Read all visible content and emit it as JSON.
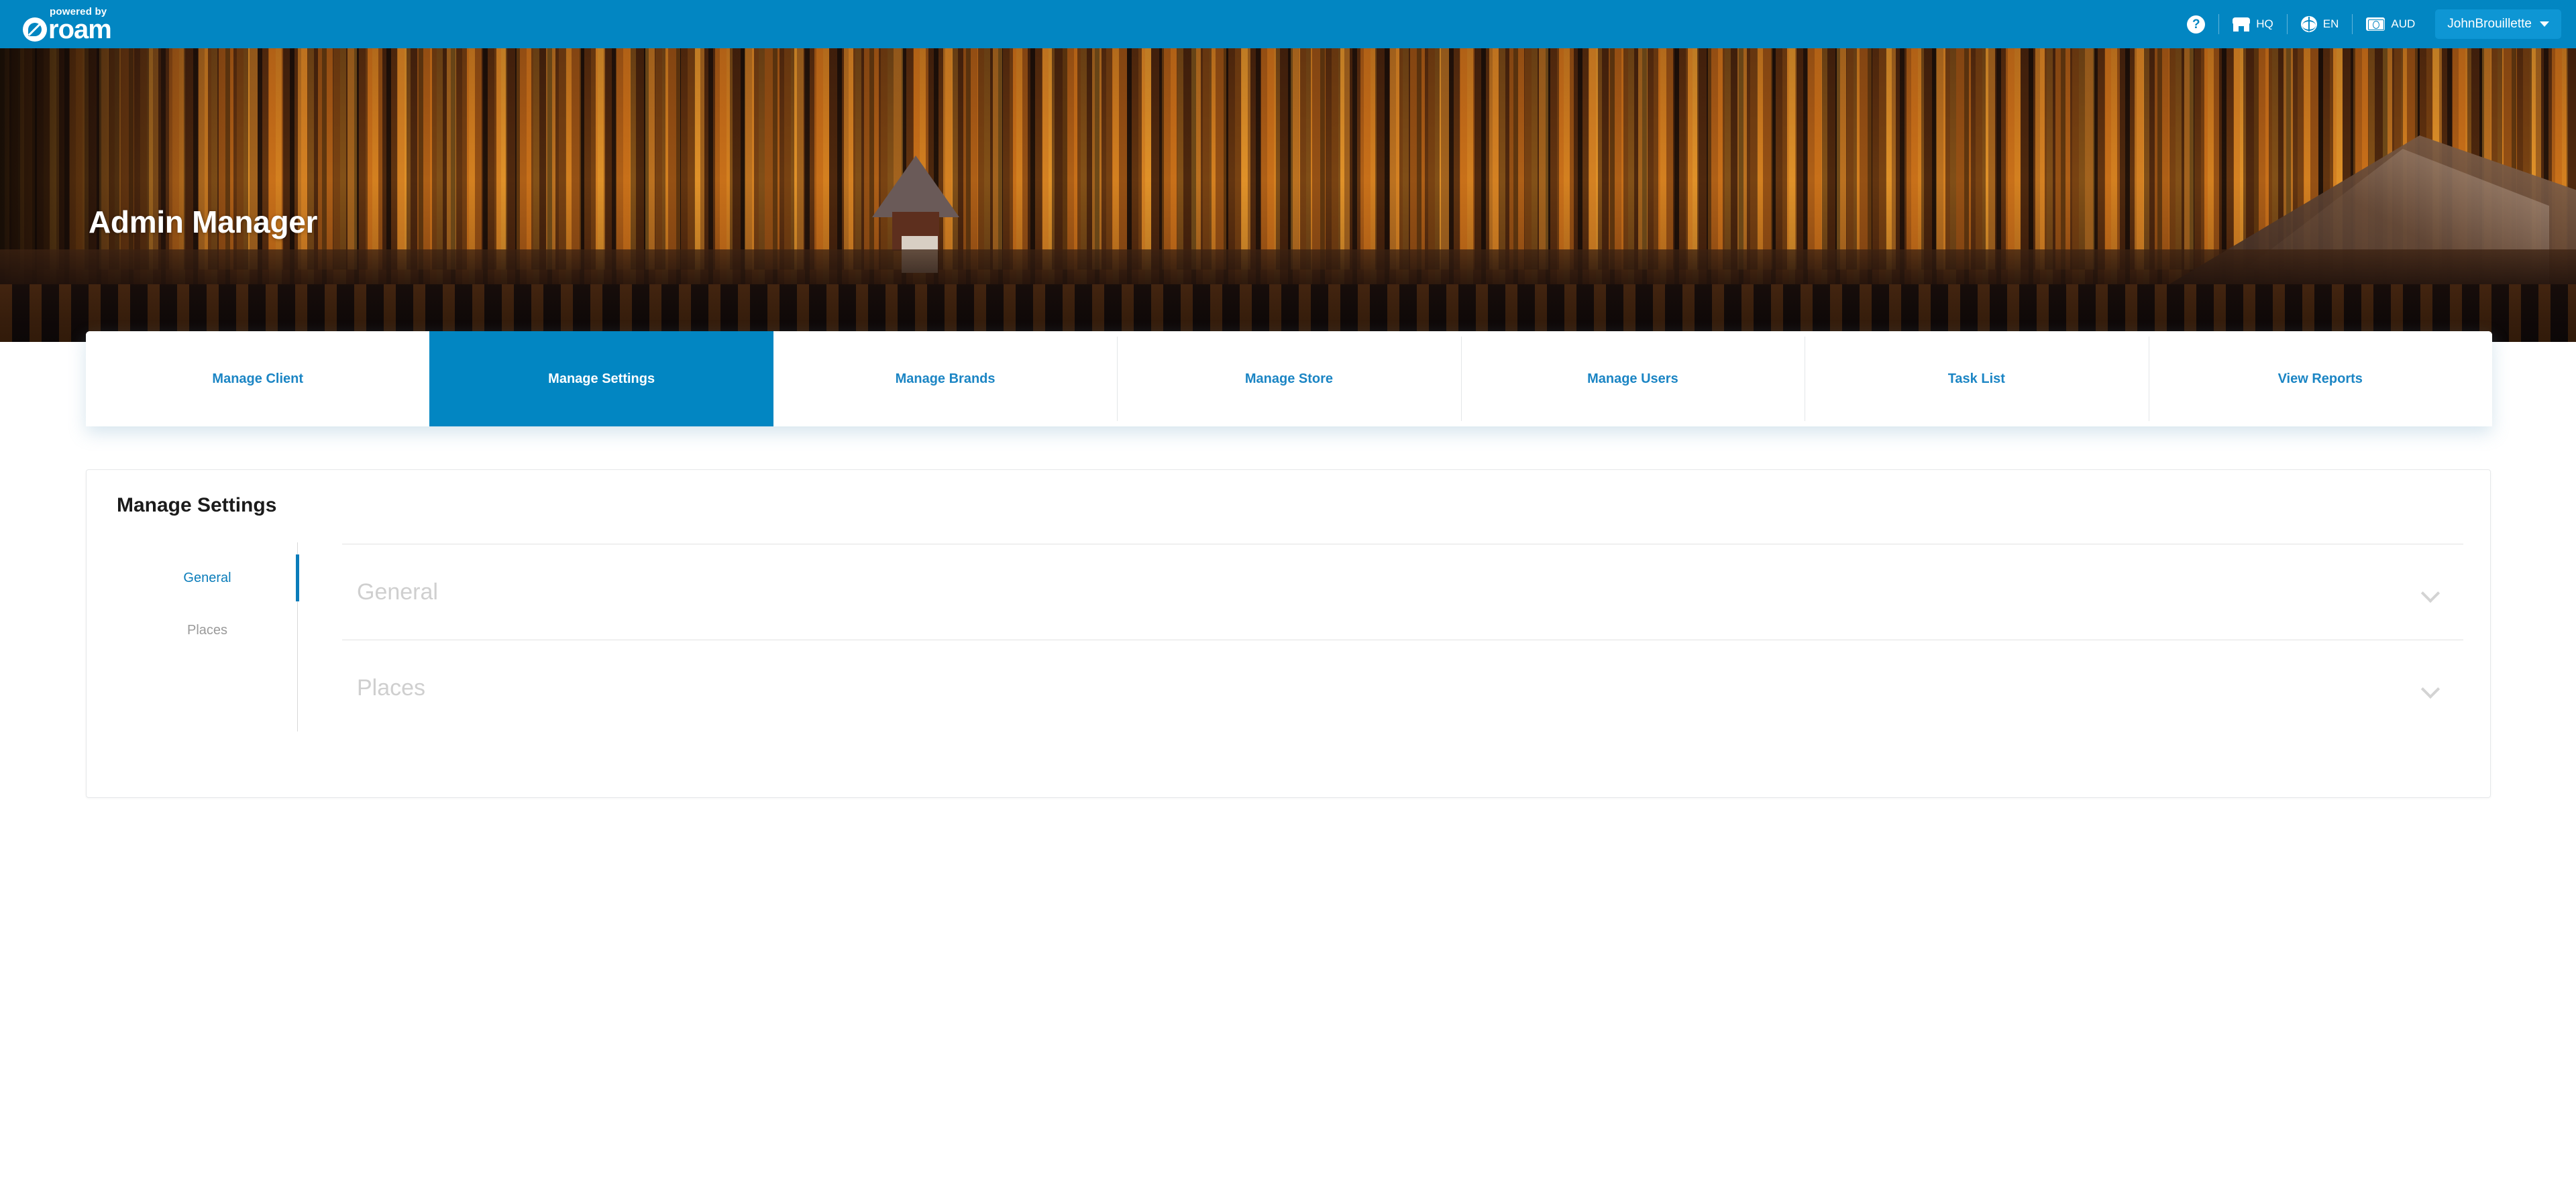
{
  "header": {
    "logo_powered": "powered by",
    "logo_word": "roam",
    "help_glyph": "?",
    "store_label": "HQ",
    "language_label": "EN",
    "currency_label": "AUD",
    "user_name": "JohnBrouillette"
  },
  "hero": {
    "title": "Admin Manager"
  },
  "tabs": [
    {
      "label": "Manage Client",
      "active": false
    },
    {
      "label": "Manage Settings",
      "active": true
    },
    {
      "label": "Manage Brands",
      "active": false
    },
    {
      "label": "Manage Store",
      "active": false
    },
    {
      "label": "Manage Users",
      "active": false
    },
    {
      "label": "Task List",
      "active": false
    },
    {
      "label": "View Reports",
      "active": false
    }
  ],
  "panel": {
    "title": "Manage Settings",
    "sidenav": [
      {
        "label": "General",
        "active": true
      },
      {
        "label": "Places",
        "active": false
      }
    ],
    "accordions": [
      {
        "label": "General",
        "expanded": false
      },
      {
        "label": "Places",
        "expanded": false
      }
    ]
  },
  "colors": {
    "brand_blue": "#0286c2",
    "user_button_blue": "#0e96d4",
    "tab_link_blue": "#1b85c4",
    "active_nav_blue": "#0a7cba",
    "muted_gray": "#cfcfcf"
  }
}
